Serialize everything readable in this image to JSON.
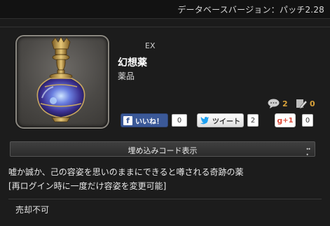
{
  "header": {
    "db_version": "データベースバージョン：パッチ2.28"
  },
  "item": {
    "ex_label": "EX",
    "name": "幻想薬",
    "category": "薬品",
    "icon": "potion-bottle-icon"
  },
  "stats": {
    "comments": "2",
    "edits": "0"
  },
  "social": {
    "facebook_label": "いいね！",
    "facebook_count": "0",
    "twitter_label": "ツイート",
    "twitter_count": "2",
    "gplus_label": "+1",
    "gplus_count": "0"
  },
  "embed": {
    "label": "埋め込みコード表示"
  },
  "description": {
    "line1": "嘘か誠か、己の容姿を思いのままにできると噂される奇跡の薬",
    "line2": "[再ログイン時に一度だけ容姿を変更可能]"
  },
  "sell_status": "売却不可",
  "colors": {
    "background": "#1b1b1b",
    "stat_accent": "#d9a23a",
    "facebook": "#3b5998",
    "gplus": "#dd4b39"
  }
}
